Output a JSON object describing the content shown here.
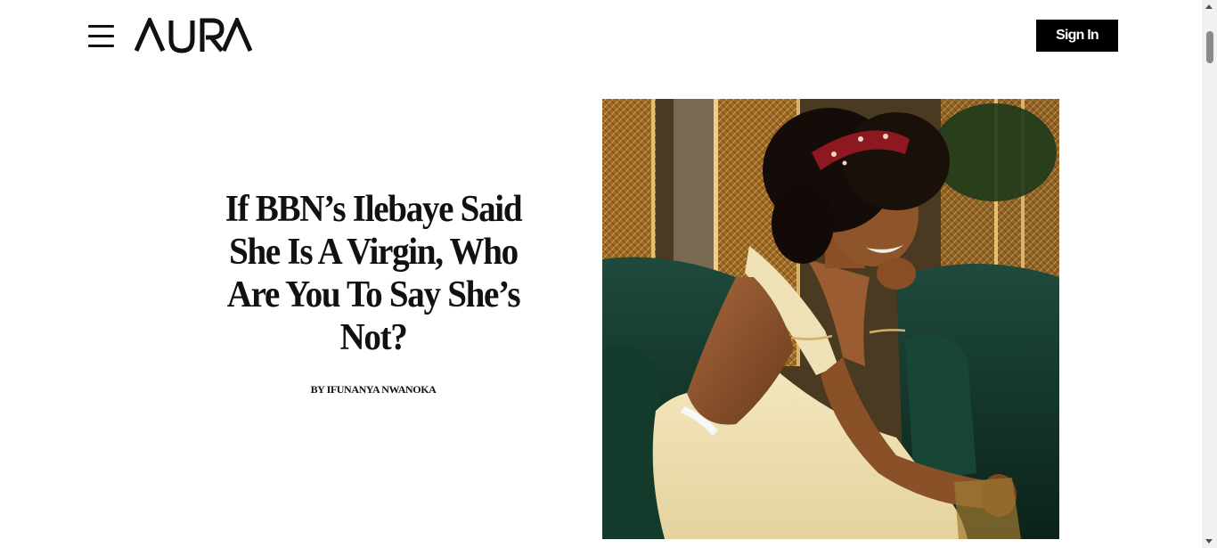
{
  "header": {
    "menu_icon": "hamburger-menu-icon",
    "logo_text": "AURA",
    "signin_label": "Sign In"
  },
  "article": {
    "headline": "If BBN’s Ilebaye Said She Is A Virgin, Who Are You To Say She’s Not?",
    "byline": "BY IFUNANYA NWANOKA"
  },
  "colors": {
    "button_bg": "#000000",
    "button_text": "#ffffff",
    "text": "#111111"
  }
}
